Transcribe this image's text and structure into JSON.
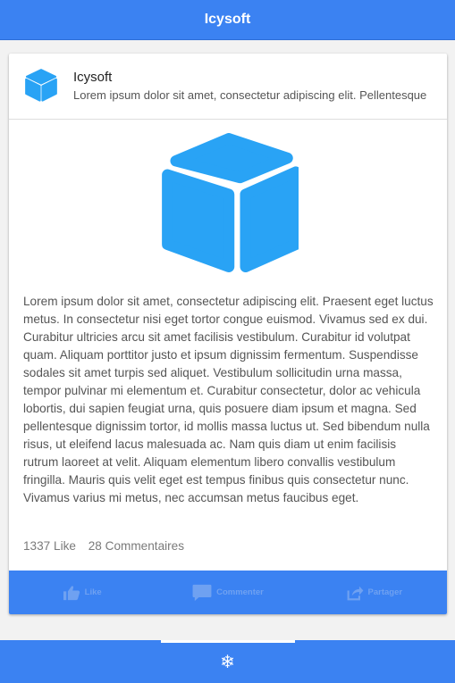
{
  "app_bar": {
    "title": "Icysoft"
  },
  "post": {
    "author": "Icysoft",
    "subtitle": "Lorem ipsum dolor sit amet, consectetur adipiscing elit. Pellentesque",
    "body": "Lorem ipsum dolor sit amet, consectetur adipiscing elit. Praesent eget luctus metus. In consectetur nisi eget tortor congue euismod. Vivamus sed ex dui. Curabitur ultricies arcu sit amet facilisis vestibulum. Curabitur id volutpat quam. Aliquam porttitor justo et ipsum dignissim fermentum. Suspendisse sodales sit amet turpis sed aliquet. Vestibulum sollicitudin urna massa, tempor pulvinar mi elementum et. Curabitur consectetur, dolor ac vehicula lobortis, dui sapien feugiat urna, quis posuere diam ipsum et magna. Sed pellentesque dignissim tortor, id mollis massa luctus ut. Sed bibendum nulla risus, ut eleifend lacus malesuada ac. Nam quis diam ut enim facilisis rutrum laoreet at velit. Aliquam elementum libero convallis vestibulum fringilla. Mauris quis velit eget est tempus finibus quis consectetur nunc. Vivamus varius mi metus, nec accumsan metus faucibus eget.",
    "likes": "1337 Like",
    "comments": "28 Commentaires",
    "actions": {
      "like": "Like",
      "comment": "Commenter",
      "share": "Partager"
    }
  },
  "bottom_bar": {
    "icon": "snowflake-icon",
    "glyph": "❄"
  },
  "colors": {
    "primary": "#3b82f2",
    "cube": "#29a3f5",
    "action_text": "#6fa1f1"
  }
}
